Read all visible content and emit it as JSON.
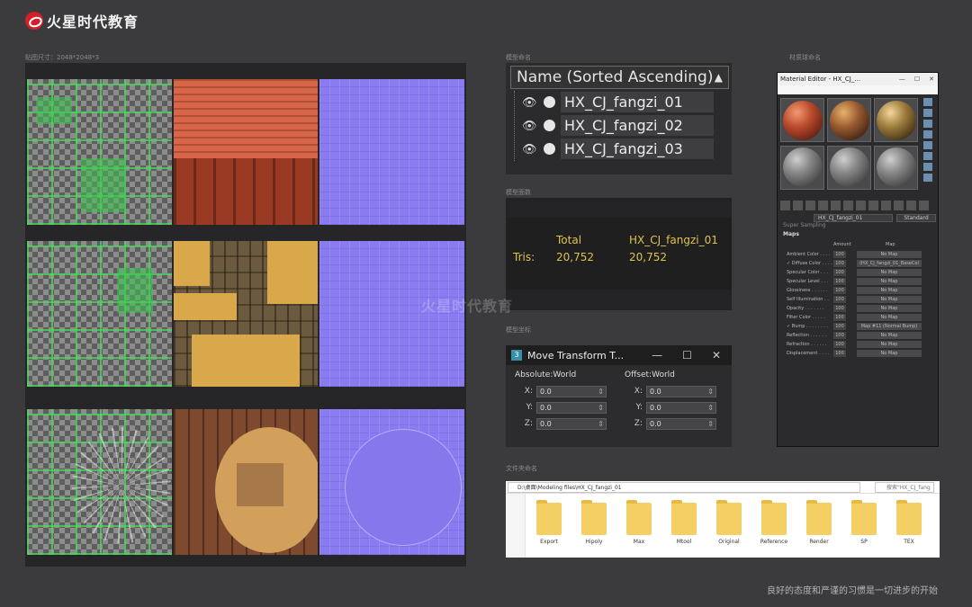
{
  "brand": {
    "name": "火星时代教育",
    "accent": "#d21f2a"
  },
  "captions": {
    "texture_size": "贴图尺寸：2048*2048*3",
    "model_naming": "模型命名",
    "model_faces": "模型面数",
    "model_coords": "模型坐标",
    "material_naming": "材质球命名",
    "file_naming": "文件夹命名"
  },
  "scene_explorer": {
    "header": "Name (Sorted Ascending)",
    "sort_arrow": "▲",
    "objects": [
      "HX_CJ_fangzi_01",
      "HX_CJ_fangzi_02",
      "HX_CJ_fangzi_03"
    ]
  },
  "stats": {
    "col_total": "Total",
    "col_selected": "HX_CJ_fangzi_01",
    "row_label": "Tris:",
    "total_value": "20,752",
    "selected_value": "20,752"
  },
  "move_transform": {
    "title": "Move Transform T...",
    "app_icon": "3",
    "controls": [
      "—",
      "☐",
      "✕"
    ],
    "absolute": {
      "title": "Absolute:World",
      "x": "0.0",
      "y": "0.0",
      "z": "0.0"
    },
    "offset": {
      "title": "Offset:World",
      "x": "0.0",
      "y": "0.0",
      "z": "0.0"
    },
    "axis_labels": [
      "X:",
      "Y:",
      "Z:"
    ]
  },
  "material_editor": {
    "title": "Material Editor - HX_CJ_...",
    "material_name": "HX_CJ_fangzi_01",
    "material_type": "Standard",
    "section_prev": "Super Sampling",
    "section": "Maps",
    "col_amount": "Amount",
    "col_map": "Map",
    "maps": [
      {
        "name": "Ambient Color . . . .",
        "amount": "100",
        "map": "No Map"
      },
      {
        "name": "✓ Diffuse Color . . . .",
        "amount": "100",
        "map": "(HX_CJ_fangzi_01_BaseCol"
      },
      {
        "name": "Specular Color . . .",
        "amount": "100",
        "map": "No Map"
      },
      {
        "name": "Specular Level . . .",
        "amount": "100",
        "map": "No Map"
      },
      {
        "name": "Glossiness . . . . . .",
        "amount": "100",
        "map": "No Map"
      },
      {
        "name": "Self Illumination . .",
        "amount": "100",
        "map": "No Map"
      },
      {
        "name": "Opacity . . . . . . .",
        "amount": "100",
        "map": "No Map"
      },
      {
        "name": "Filter Color . . . . .",
        "amount": "100",
        "map": "No Map"
      },
      {
        "name": "✓ Bump . . . . . . . .",
        "amount": "100",
        "map": "Map #11 (Normal Bump)"
      },
      {
        "name": "Reflection . . . . . .",
        "amount": "100",
        "map": "No Map"
      },
      {
        "name": "Refraction . . . . . .",
        "amount": "100",
        "map": "No Map"
      },
      {
        "name": "Displacement . . . .",
        "amount": "100",
        "map": "No Map"
      }
    ]
  },
  "file_explorer": {
    "path": "D:\\桌面\\Modeling files\\HX_CJ_fangzi_01",
    "search_placeholder": "搜索\"HX_CJ_fang",
    "folders": [
      "Export",
      "Hipoly",
      "Max",
      "Mtool",
      "Original",
      "Reference",
      "Render",
      "SP",
      "TEX"
    ]
  },
  "motto": "良好的态度和严谨的习惯是一切进步的开始"
}
